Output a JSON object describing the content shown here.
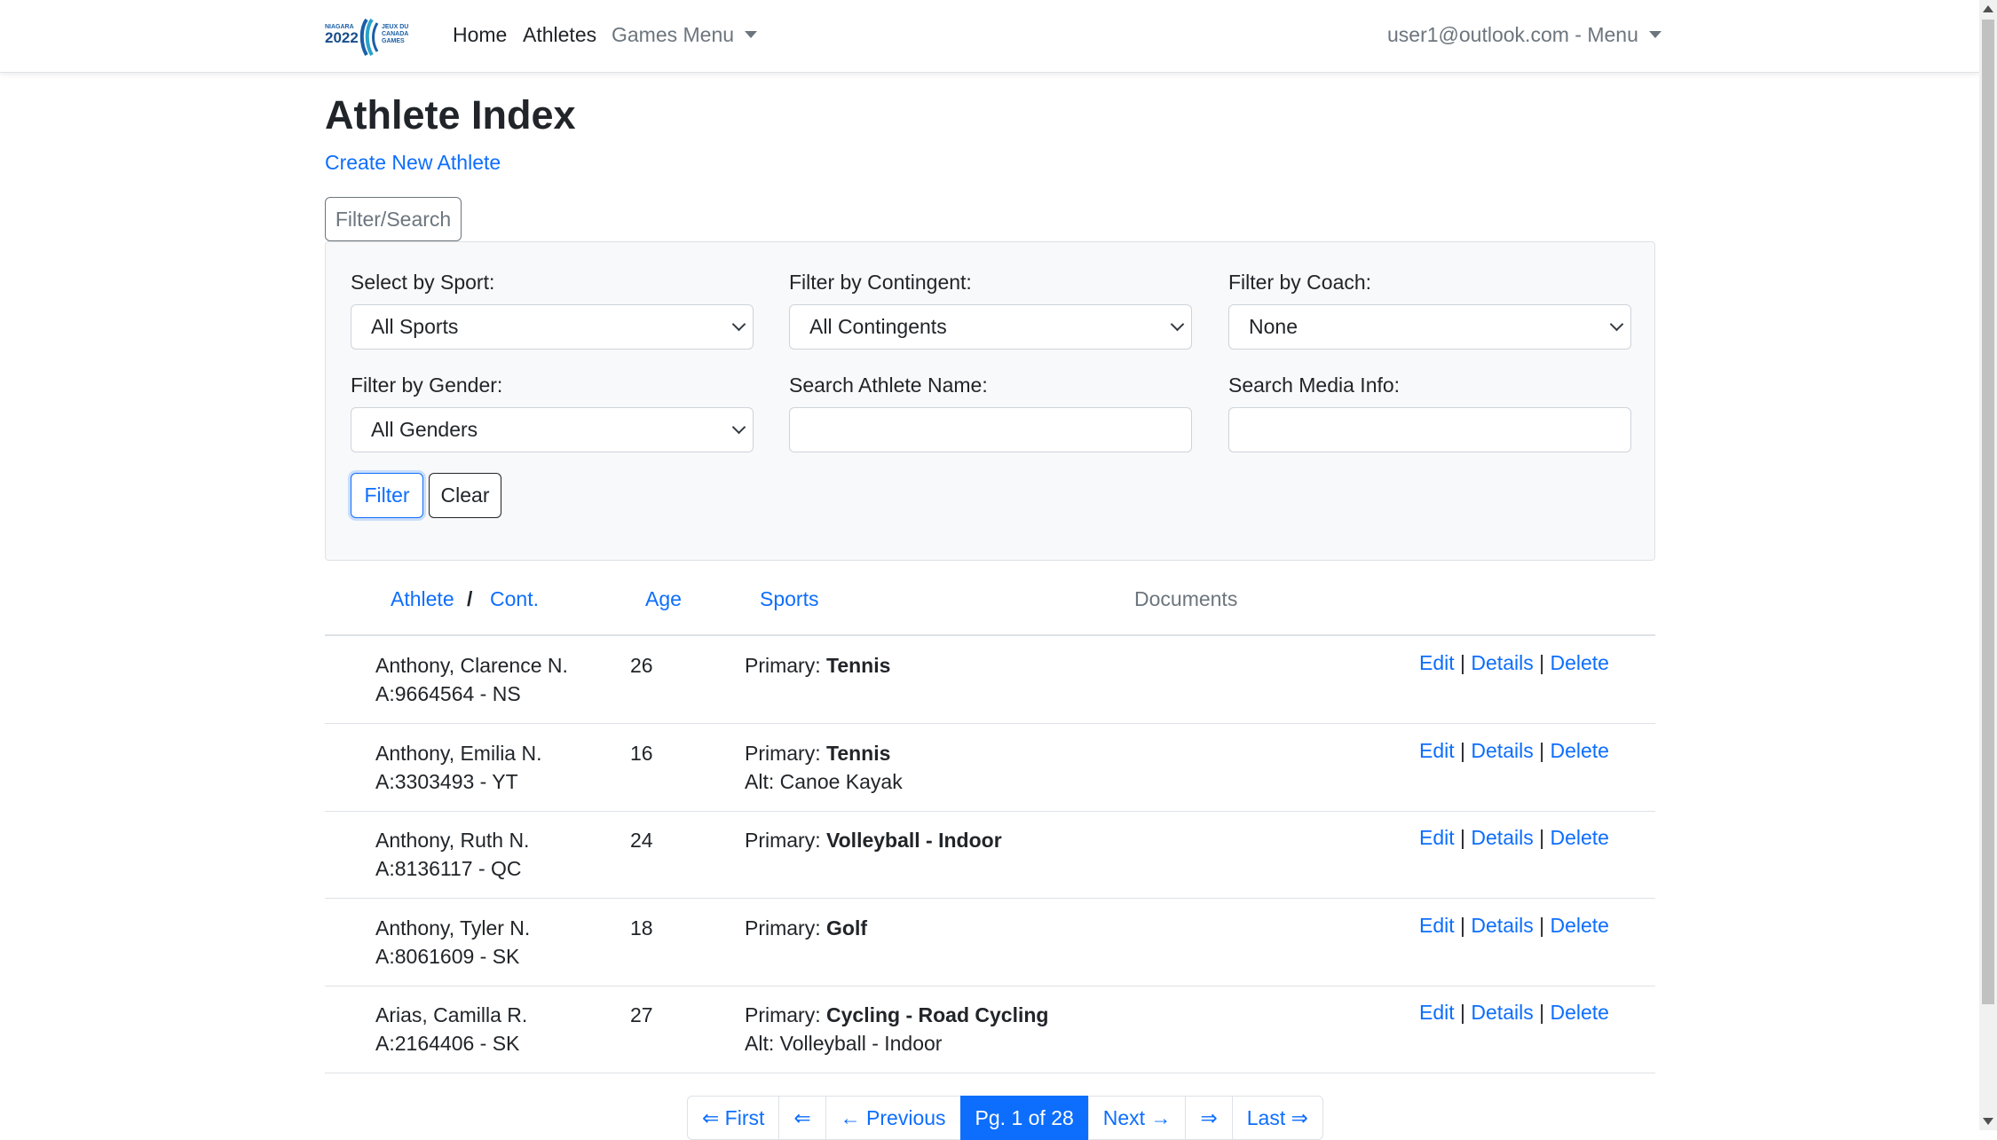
{
  "nav": {
    "logo_text": [
      "NIAGARA",
      "2022",
      "JEUX DU",
      "CANADA",
      "GAMES"
    ],
    "home": "Home",
    "athletes": "Athletes",
    "games_menu": "Games Menu",
    "user_menu": "user1@outlook.com - Menu"
  },
  "page": {
    "title": "Athlete Index",
    "create_link": "Create New Athlete",
    "filter_toggle": "Filter/Search"
  },
  "filters": {
    "sport_label": "Select by Sport:",
    "sport_value": "All Sports",
    "contingent_label": "Filter by Contingent:",
    "contingent_value": "All Contingents",
    "coach_label": "Filter by Coach:",
    "coach_value": "None",
    "gender_label": "Filter by Gender:",
    "gender_value": "All Genders",
    "name_label": "Search Athlete Name:",
    "name_value": "",
    "media_label": "Search Media Info:",
    "media_value": "",
    "filter_button": "Filter",
    "clear_button": "Clear"
  },
  "table": {
    "headers": {
      "athlete": "Athlete",
      "slash": "/",
      "cont": "Cont.",
      "age": "Age",
      "sports": "Sports",
      "documents": "Documents"
    },
    "primary_prefix": "Primary: ",
    "alt_prefix": "Alt: ",
    "actions": {
      "edit": "Edit",
      "details": "Details",
      "delete": "Delete",
      "sep": "|"
    },
    "rows": [
      {
        "name": "Anthony, Clarence N.",
        "code": "A:9664564 - NS",
        "age": "26",
        "primary": "Tennis",
        "alt": ""
      },
      {
        "name": "Anthony, Emilia N.",
        "code": "A:3303493 - YT",
        "age": "16",
        "primary": "Tennis",
        "alt": "Canoe Kayak"
      },
      {
        "name": "Anthony, Ruth N.",
        "code": "A:8136117 - QC",
        "age": "24",
        "primary": "Volleyball - Indoor",
        "alt": ""
      },
      {
        "name": "Anthony, Tyler N.",
        "code": "A:8061609 - SK",
        "age": "18",
        "primary": "Golf",
        "alt": ""
      },
      {
        "name": "Arias, Camilla R.",
        "code": "A:2164406 - SK",
        "age": "27",
        "primary": "Cycling - Road Cycling",
        "alt": "Volleyball - Indoor"
      }
    ]
  },
  "pagination": {
    "first": "⇐ First",
    "prev_arrow": "⇐",
    "previous": "← Previous",
    "current": "Pg. 1 of 28",
    "next": "Next →",
    "next_arrow": "⇒",
    "last": "Last ⇒"
  },
  "colors": {
    "link": "#0d6efd",
    "muted": "#6c757d",
    "logo_blue": "#1a5fa8",
    "logo_teal": "#2aa3c8"
  }
}
